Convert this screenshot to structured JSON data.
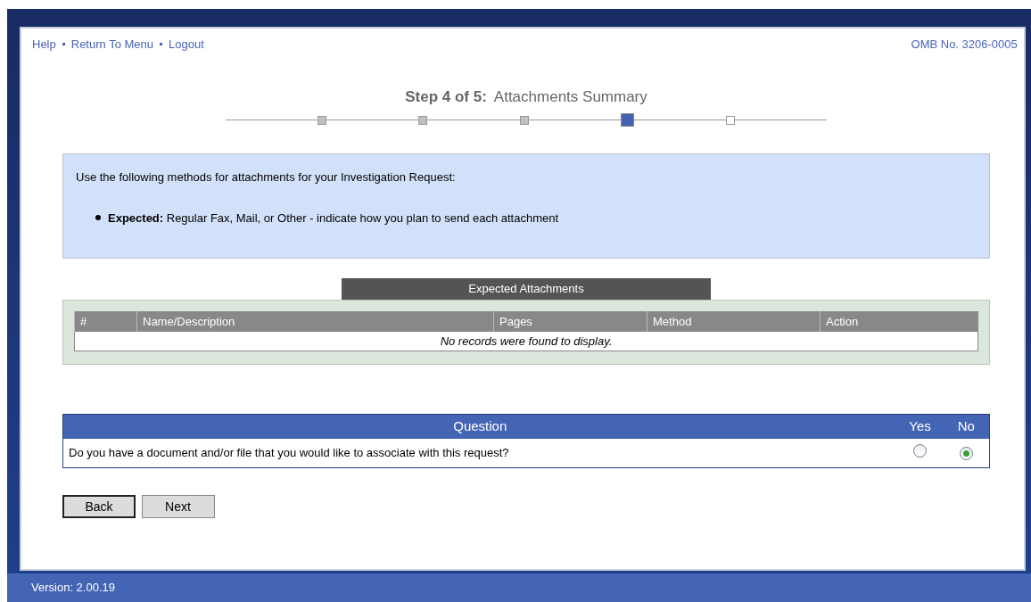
{
  "nav_links": [
    "Help",
    "Return To Menu",
    "Logout"
  ],
  "omb_number": "OMB No. 3206-0005",
  "step": {
    "label": "Step 4 of 5:",
    "title": "Attachments Summary"
  },
  "progress_steps": [
    {
      "kind": "done"
    },
    {
      "kind": "done"
    },
    {
      "kind": "done"
    },
    {
      "kind": "current"
    },
    {
      "kind": "todo"
    }
  ],
  "info": {
    "intro": "Use the following methods for attachments for your Investigation Request:",
    "bullets": [
      "**Expected:** Regular Fax, Mail, or Other - indicate how you plan to send each attachment"
    ]
  },
  "attachments": {
    "title": "Expected Attachments",
    "columns": [
      "#",
      "Name/Description",
      "Pages",
      "Method",
      "Action"
    ],
    "empty_message": "No records were found to display."
  },
  "question_table": {
    "columns": [
      "Question",
      "Yes",
      "No"
    ],
    "rows": [
      {
        "question": "Do you have a document and/or file that you would like to associate with this request?",
        "answers": [
          {
            "selected": false
          },
          {
            "selected": true
          }
        ]
      }
    ]
  },
  "buttons": [
    {
      "label": "Back",
      "focused": true
    },
    {
      "label": "Next",
      "focused": false
    }
  ],
  "status_bar": "Version: 2.00.19"
}
